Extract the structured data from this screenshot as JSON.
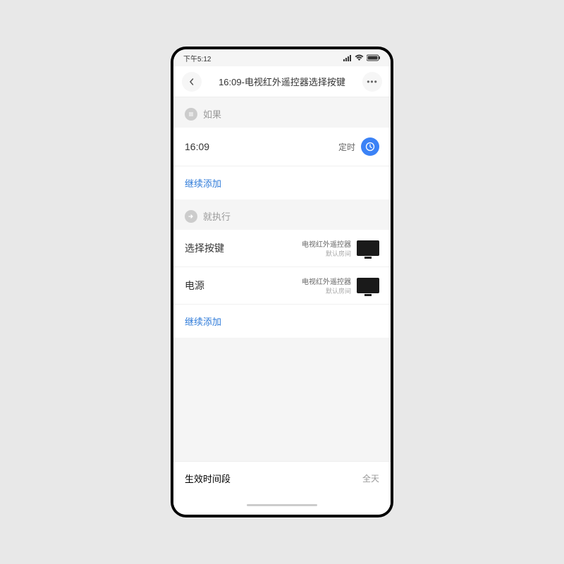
{
  "statusbar": {
    "time": "下午5:12"
  },
  "navbar": {
    "title": "16:09-电视红外遥控器选择按键"
  },
  "sections": {
    "if": {
      "label": "如果",
      "time_value": "16:09",
      "time_type": "定时",
      "add_link": "继续添加"
    },
    "then": {
      "label": "就执行",
      "items": [
        {
          "title": "选择按键",
          "device": "电视红外遥控器",
          "room": "默认房间"
        },
        {
          "title": "电源",
          "device": "电视红外遥控器",
          "room": "默认房间"
        }
      ],
      "add_link": "继续添加"
    }
  },
  "footer": {
    "label": "生效时间段",
    "value": "全天"
  }
}
